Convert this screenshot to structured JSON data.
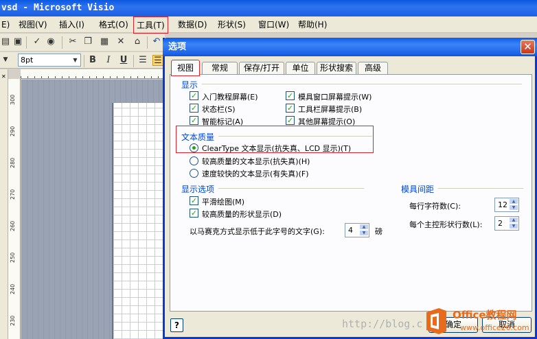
{
  "window": {
    "title": "vsd - Microsoft Visio"
  },
  "menubar": {
    "items": [
      {
        "label": "E)"
      },
      {
        "label": "视图(V)"
      },
      {
        "label": "插入(I)"
      },
      {
        "label": "格式(O)"
      },
      {
        "label": "工具(T)"
      },
      {
        "label": "数据(D)"
      },
      {
        "label": "形状(S)"
      },
      {
        "label": "窗口(W)"
      },
      {
        "label": "帮助(H)"
      }
    ]
  },
  "toolbar": {
    "font_size": "8pt",
    "bold": "B",
    "italic": "I",
    "underline": "U"
  },
  "ruler": {
    "ticks": [
      "300",
      "290",
      "280",
      "270",
      "260",
      "250",
      "240",
      "230"
    ]
  },
  "dialog": {
    "title": "选项",
    "tabs": [
      {
        "label": "视图"
      },
      {
        "label": "常规"
      },
      {
        "label": "保存/打开"
      },
      {
        "label": "单位"
      },
      {
        "label": "形状搜索"
      },
      {
        "label": "高级"
      }
    ],
    "display": {
      "heading": "显示",
      "checkboxes": [
        {
          "label": "入门教程屏幕(E)",
          "checked": true
        },
        {
          "label": "模具窗口屏幕提示(W)",
          "checked": true
        },
        {
          "label": "状态栏(S)",
          "checked": true
        },
        {
          "label": "工具栏屏幕提示(B)",
          "checked": true
        },
        {
          "label": "智能标记(A)",
          "checked": true
        },
        {
          "label": "其他屏幕提示(O)",
          "checked": true
        }
      ]
    },
    "text_quality": {
      "heading": "文本质量",
      "options": [
        {
          "label": "ClearType 文本显示(抗失真、LCD 显示)(T)",
          "selected": true
        },
        {
          "label": "较高质量的文本显示(抗失真)(H)",
          "selected": false
        },
        {
          "label": "速度较快的文本显示(有失真)(F)",
          "selected": false
        }
      ]
    },
    "display_options": {
      "heading": "显示选项",
      "checkboxes": [
        {
          "label": "平滑绘图(M)",
          "checked": true
        },
        {
          "label": "较高质量的形状显示(D)",
          "checked": true
        }
      ],
      "greek_label": "以马赛克方式显示低于此字号的文字(G):",
      "greek_value": "4",
      "greek_unit": "磅"
    },
    "stencil_spacing": {
      "heading": "模具间距",
      "chars_label": "每行字符数(C):",
      "chars_value": "12",
      "rows_label": "每个主控形状行数(L):",
      "rows_value": "2"
    },
    "help": "?",
    "ok": "确定",
    "cancel": "取消"
  },
  "watermark": "http://blog.c",
  "logo": {
    "title": "Office教程网",
    "url": "www.office26.com"
  },
  "colors": {
    "accent": "#0a58e0",
    "highlight": "#e2202a",
    "group_label": "#0046d5",
    "logo": "#e86b1c"
  }
}
